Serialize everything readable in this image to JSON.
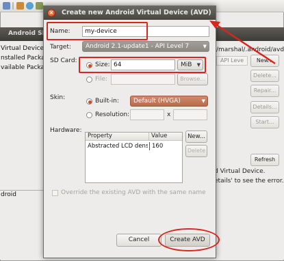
{
  "background_app": {
    "title": "Android SD",
    "left_list": [
      "Virtual Devices",
      "nstalled Packag",
      "vailable Packag"
    ],
    "bottom_label": "droid",
    "path_text": "/marshal/.android/avd",
    "column_header": "API Leve",
    "buttons": {
      "new": "New...",
      "delete": "Delete...",
      "repair": "Repair...",
      "details": "Details...",
      "start": "Start...",
      "refresh": "Refresh"
    },
    "status_line1": "d Virtual Device.",
    "status_line2": "etails' to see the error."
  },
  "dialog": {
    "title": "Create new Android Virtual Device (AVD)",
    "name": {
      "label": "Name:",
      "value": "my-device"
    },
    "target": {
      "label": "Target:",
      "selected": "Android 2.1-update1 - API Level 7"
    },
    "sd_card": {
      "label": "SD Card:",
      "size_label": "Size:",
      "size_value": "64",
      "size_unit": "MiB",
      "file_label": "File:",
      "browse_button": "Browse..."
    },
    "skin": {
      "label": "Skin:",
      "builtin_label": "Built-in:",
      "builtin_selected": "Default (HVGA)",
      "resolution_label": "Resolution:",
      "resolution_separator": "x"
    },
    "hardware": {
      "label": "Hardware:",
      "columns": [
        "Property",
        "Value"
      ],
      "rows": [
        {
          "property": "Abstracted LCD densit",
          "value": "160"
        }
      ],
      "new_button": "New...",
      "delete_button": "Delete"
    },
    "override_label": "Override the existing AVD with the same name",
    "cancel_button": "Cancel",
    "create_button": "Create AVD"
  },
  "colors": {
    "annotation": "#d9261c",
    "selected_radio": "#d9481c",
    "titlebar": "#4a4842"
  }
}
